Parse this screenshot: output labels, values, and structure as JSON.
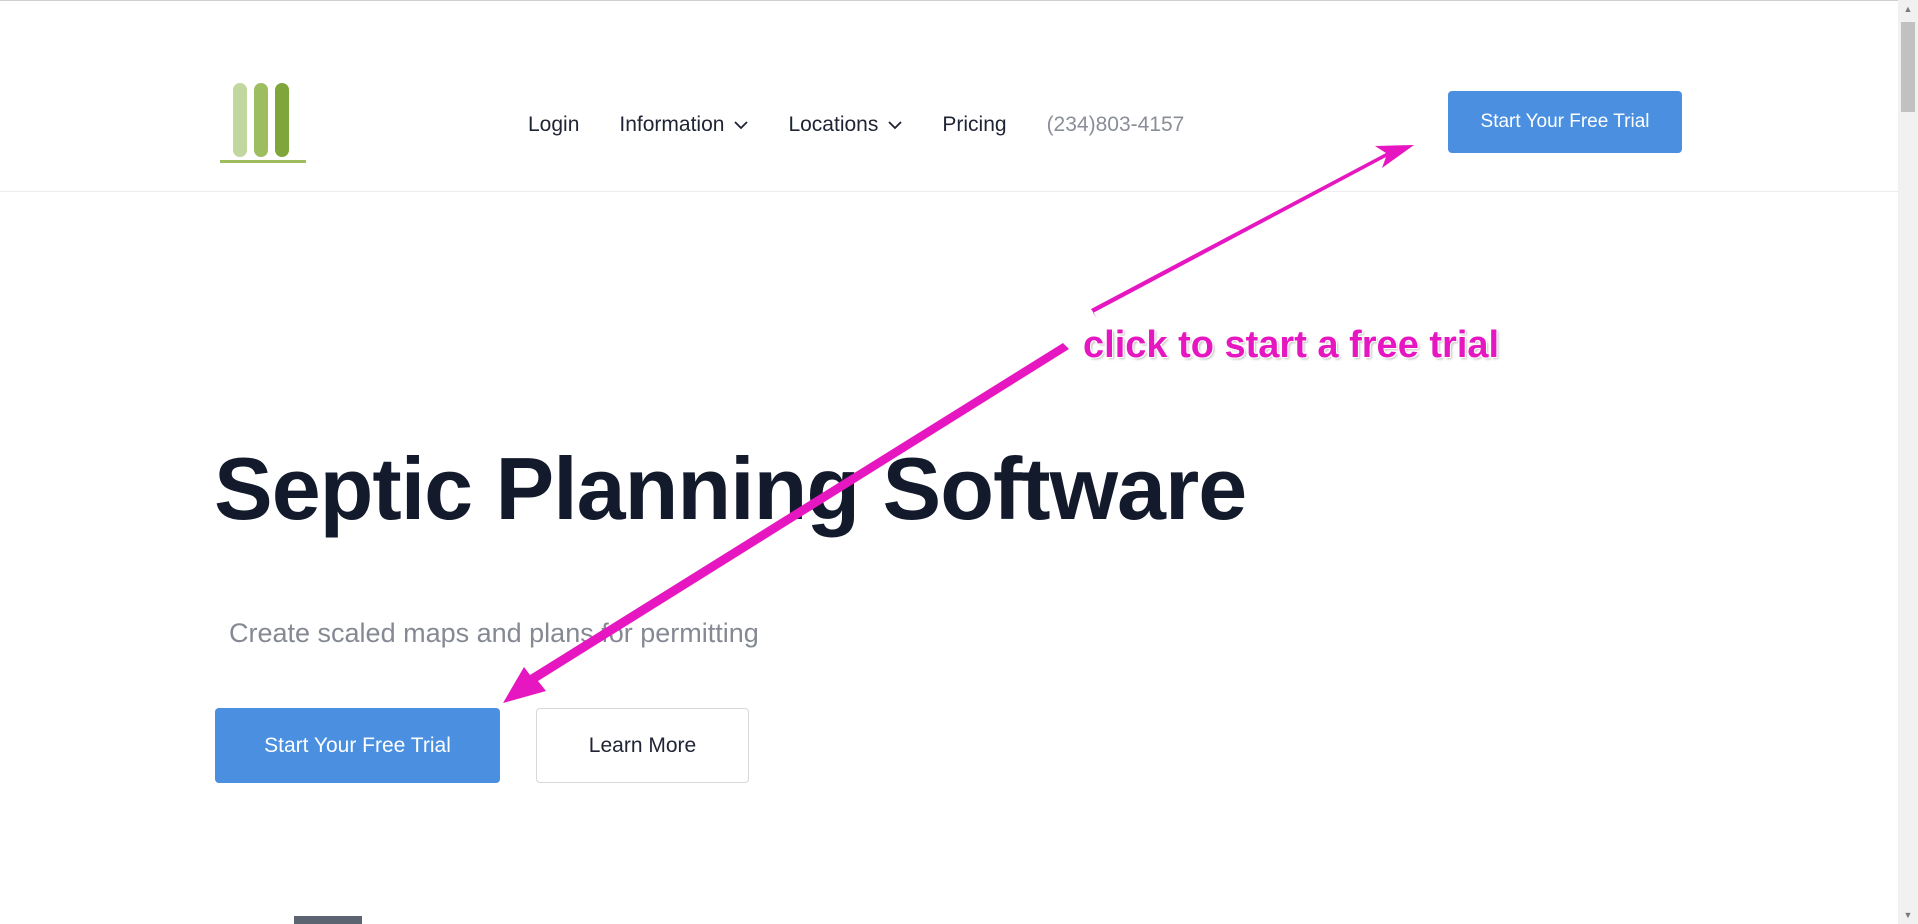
{
  "header": {
    "logo_icon": "three-bars-logo-icon",
    "nav": [
      {
        "label": "Login",
        "has_dropdown": false
      },
      {
        "label": "Information",
        "has_dropdown": true
      },
      {
        "label": "Locations",
        "has_dropdown": true
      },
      {
        "label": "Pricing",
        "has_dropdown": false
      }
    ],
    "phone": "(234)803-4157",
    "cta_label": "Start Your Free Trial"
  },
  "hero": {
    "title": "Septic Planning Software",
    "subtitle": "Create scaled maps and plans for permitting",
    "primary_label": "Start Your Free Trial",
    "secondary_label": "Learn More"
  },
  "annotation": {
    "text": "click to start a free trial",
    "color": "#e617c0"
  },
  "colors": {
    "brand_button": "#4a8fe0",
    "logo_light_green": "#b7cf8e",
    "logo_dark_green": "#7fa63a",
    "title": "#121a2c"
  }
}
